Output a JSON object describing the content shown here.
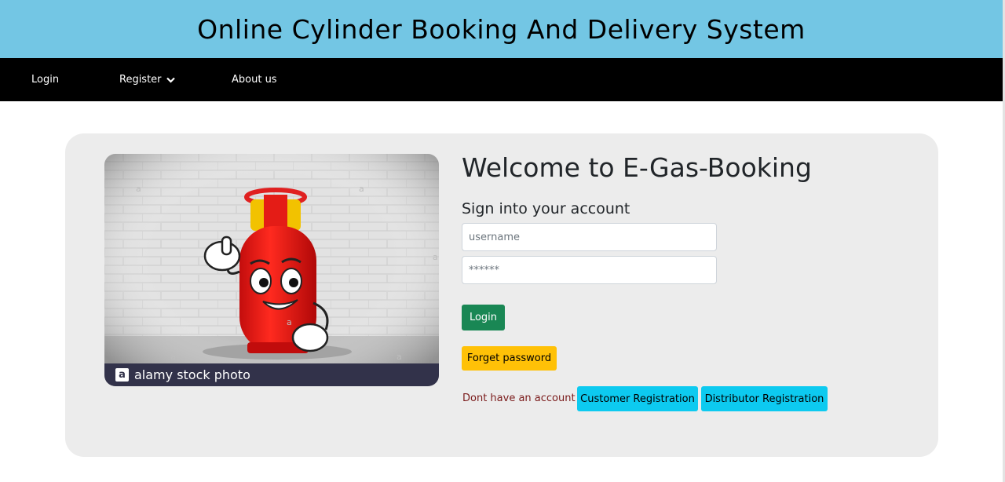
{
  "header": {
    "title": "Online Cylinder Booking And Delivery System"
  },
  "nav": {
    "login": "Login",
    "register": "Register",
    "about": "About us"
  },
  "photo": {
    "watermark_logo": "a",
    "caption": "alamy stock photo"
  },
  "form": {
    "welcome": "Welcome to E-Gas-Booking",
    "signin": "Sign into your account",
    "username_placeholder": "username",
    "password_placeholder": "******",
    "login_button": "Login",
    "forget_button": "Forget password",
    "no_account": "Dont have an account ?",
    "customer_registration": "Customer Registration",
    "distributor_registration": "Distributor Registration"
  },
  "colors": {
    "header_bg": "#73c6e4",
    "nav_bg": "#000000",
    "card_bg": "#ececec",
    "login_btn": "#198754",
    "forget_btn": "#ffc107",
    "register_btn": "#0dcaf0"
  }
}
